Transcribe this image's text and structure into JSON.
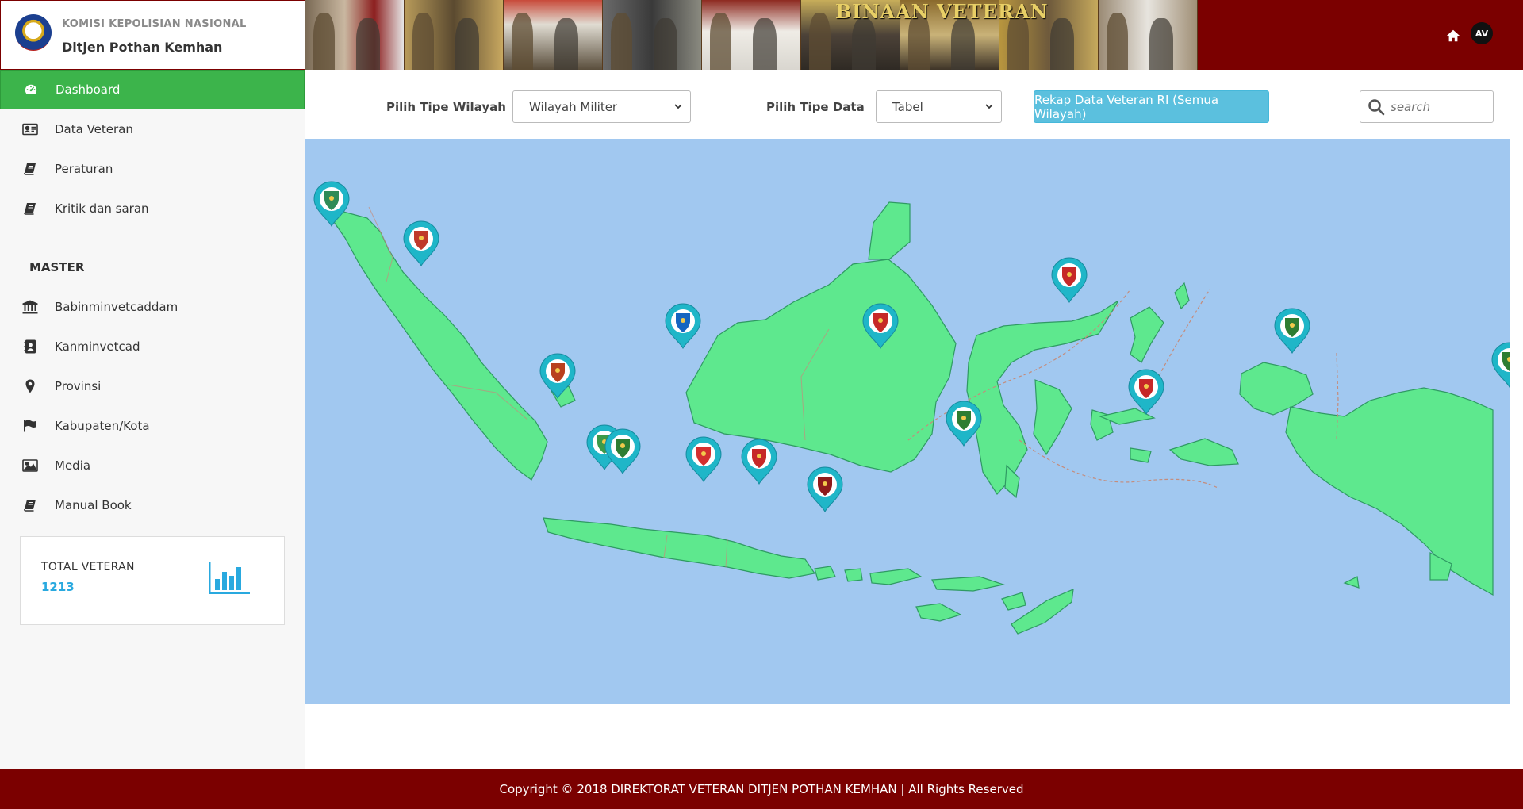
{
  "brand": {
    "org_name": "KOMISI KEPOLISIAN NASIONAL",
    "unit_name": "Ditjen Pothan Kemhan"
  },
  "header": {
    "banner_text": "BINAAN VETERAN",
    "user_initials": "AV",
    "home_icon": "home-icon"
  },
  "sidebar": {
    "items": [
      {
        "label": "Dashboard",
        "icon": "dashboard-icon",
        "active": true
      },
      {
        "label": "Data Veteran",
        "icon": "id-card-icon",
        "active": false
      },
      {
        "label": "Peraturan",
        "icon": "book-icon",
        "active": false
      },
      {
        "label": "Kritik dan saran",
        "icon": "book-icon",
        "active": false
      }
    ],
    "master_heading": "MASTER",
    "master_items": [
      {
        "label": "Babinminvetcaddam",
        "icon": "bank-icon"
      },
      {
        "label": "Kanminvetcad",
        "icon": "address-book-icon"
      },
      {
        "label": "Provinsi",
        "icon": "map-marker-icon"
      },
      {
        "label": "Kabupaten/Kota",
        "icon": "flag-icon"
      },
      {
        "label": "Media",
        "icon": "image-icon"
      },
      {
        "label": "Manual Book",
        "icon": "book-icon"
      }
    ],
    "total_label": "TOTAL VETERAN",
    "total_value": "1213",
    "total_icon": "bar-chart-icon"
  },
  "filters": {
    "wilayah_label": "Pilih Tipe Wilayah",
    "wilayah_value": "Wilayah Militer",
    "data_label": "Pilih Tipe Data",
    "data_value": "Tabel",
    "rekap_button": "Rekap Data Veteran RI (Semua Wilayah)",
    "search_placeholder": "search"
  },
  "map": {
    "land_color": "#5ee88e",
    "sea_color": "#a1c8f0",
    "marker_color": "#1fb6c8",
    "markers": [
      {
        "name": "marker-aceh",
        "emblem": "#2e8b57"
      },
      {
        "name": "marker-sumut",
        "emblem": "#c0392b"
      },
      {
        "name": "marker-sumsel",
        "emblem": "#b8401e"
      },
      {
        "name": "marker-jakarta",
        "emblem": "#3c9a4a"
      },
      {
        "name": "marker-jabar",
        "emblem": "#2e7d32"
      },
      {
        "name": "marker-jateng",
        "emblem": "#d32f2f"
      },
      {
        "name": "marker-jatim",
        "emblem": "#c62828"
      },
      {
        "name": "marker-bali",
        "emblem": "#8e1b1b"
      },
      {
        "name": "marker-kalbar",
        "emblem": "#1565c0"
      },
      {
        "name": "marker-kaltim",
        "emblem": "#c62828"
      },
      {
        "name": "marker-sulsel",
        "emblem": "#2e7d32"
      },
      {
        "name": "marker-sulut",
        "emblem": "#c62828"
      },
      {
        "name": "marker-maluku",
        "emblem": "#c62828"
      },
      {
        "name": "marker-papua-barat",
        "emblem": "#2e7d32"
      },
      {
        "name": "marker-papua",
        "emblem": "#2e7d32"
      }
    ]
  },
  "footer": {
    "copyright": "Copyright © 2018 DIREKTORAT VETERAN DITJEN POTHAN KEMHAN | All Rights Reserved"
  }
}
